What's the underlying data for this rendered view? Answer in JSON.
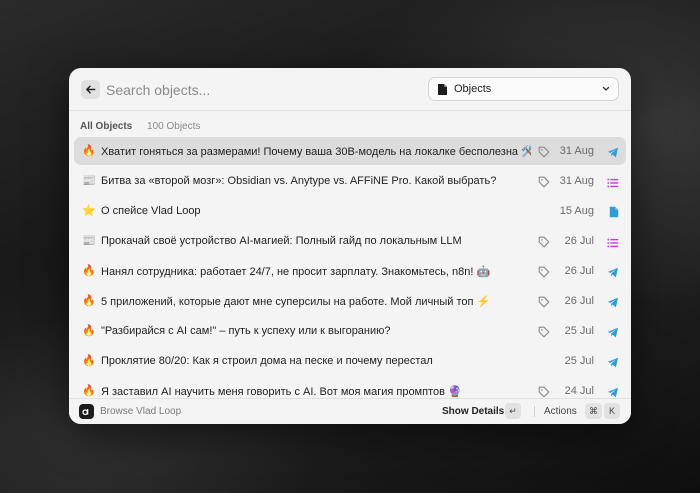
{
  "search": {
    "placeholder": "Search objects..."
  },
  "filter": {
    "selected": "Objects"
  },
  "section": {
    "title": "All Objects",
    "count": "100 Objects"
  },
  "items": [
    {
      "emoji": "🔥",
      "title": "Хватит гоняться за размерами! Почему ваша 30B-модель на локалке бесполезна 🛠️",
      "tagged": true,
      "date": "31 Aug",
      "type": "telegram-icon",
      "selected": true
    },
    {
      "emoji": "📰",
      "title": "Битва за «второй мозг»: Obsidian vs. Anytype vs. AFFiNE Pro. Какой выбрать?",
      "tagged": true,
      "date": "31 Aug",
      "type": "list-icon",
      "selected": false
    },
    {
      "emoji": "⭐",
      "title": "О спейсе Vlad Loop",
      "tagged": false,
      "date": "15 Aug",
      "type": "document-icon",
      "selected": false
    },
    {
      "emoji": "📰",
      "title": "Прокачай своё устройство AI-магией: Полный гайд по локальным LLM",
      "tagged": true,
      "date": "26 Jul",
      "type": "list-icon",
      "selected": false
    },
    {
      "emoji": "🔥",
      "title": "Нанял сотрудника: работает 24/7, не просит зарплату. Знакомьтесь, n8n! 🤖",
      "tagged": true,
      "date": "26 Jul",
      "type": "telegram-icon",
      "selected": false
    },
    {
      "emoji": "🔥",
      "title": "5 приложений, которые дают мне суперсилы на работе. Мой личный топ ⚡",
      "tagged": true,
      "date": "26 Jul",
      "type": "telegram-icon",
      "selected": false
    },
    {
      "emoji": "🔥",
      "title": "\"Разбирайся с AI сам!\" – путь к успеху или к выгоранию?",
      "tagged": true,
      "date": "25 Jul",
      "type": "telegram-icon",
      "selected": false
    },
    {
      "emoji": "🔥",
      "title": "Проклятие 80/20: Как я строил дома на песке и почему перестал",
      "tagged": false,
      "date": "25 Jul",
      "type": "telegram-icon",
      "selected": false
    },
    {
      "emoji": "🔥",
      "title": "Я заставил AI научить меня говорить с AI. Вот моя магия промптов 🔮",
      "tagged": true,
      "date": "24 Jul",
      "type": "telegram-icon",
      "selected": false
    }
  ],
  "footer": {
    "browse": "Browse Vlad Loop",
    "show_details": "Show Details",
    "enter_key": "↵",
    "actions": "Actions",
    "cmd_key": "⌘",
    "k_key": "K"
  },
  "colors": {
    "accent": "#2d9cdb",
    "list": "#c53fd6",
    "tag": "#8a8a8a"
  }
}
